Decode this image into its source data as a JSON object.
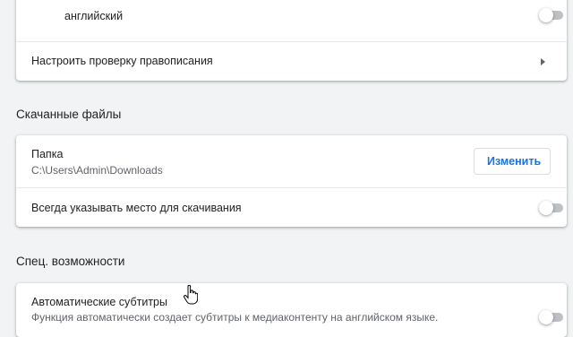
{
  "spellcheck": {
    "language_label": "английский",
    "language_enabled": false,
    "customize_label": "Настроить проверку правописания"
  },
  "downloads": {
    "section_title": "Скачанные файлы",
    "folder_label": "Папка",
    "folder_path": "C:\\Users\\Admin\\Downloads",
    "change_button": "Изменить",
    "ask_location_label": "Всегда указывать место для скачивания",
    "ask_location_enabled": false
  },
  "accessibility": {
    "section_title": "Спец. возможности",
    "captions_label": "Автоматические субтитры",
    "captions_description": "Функция автоматически создает субтитры к медиаконтенту на английском языке.",
    "captions_enabled": false
  },
  "icons": {
    "chevron": "chevron-right-icon",
    "cursor": "hand-pointer-icon"
  },
  "colors": {
    "accent": "#1a73e8",
    "background": "#f1f3f4",
    "toggle_off": "#bdc1c6"
  }
}
